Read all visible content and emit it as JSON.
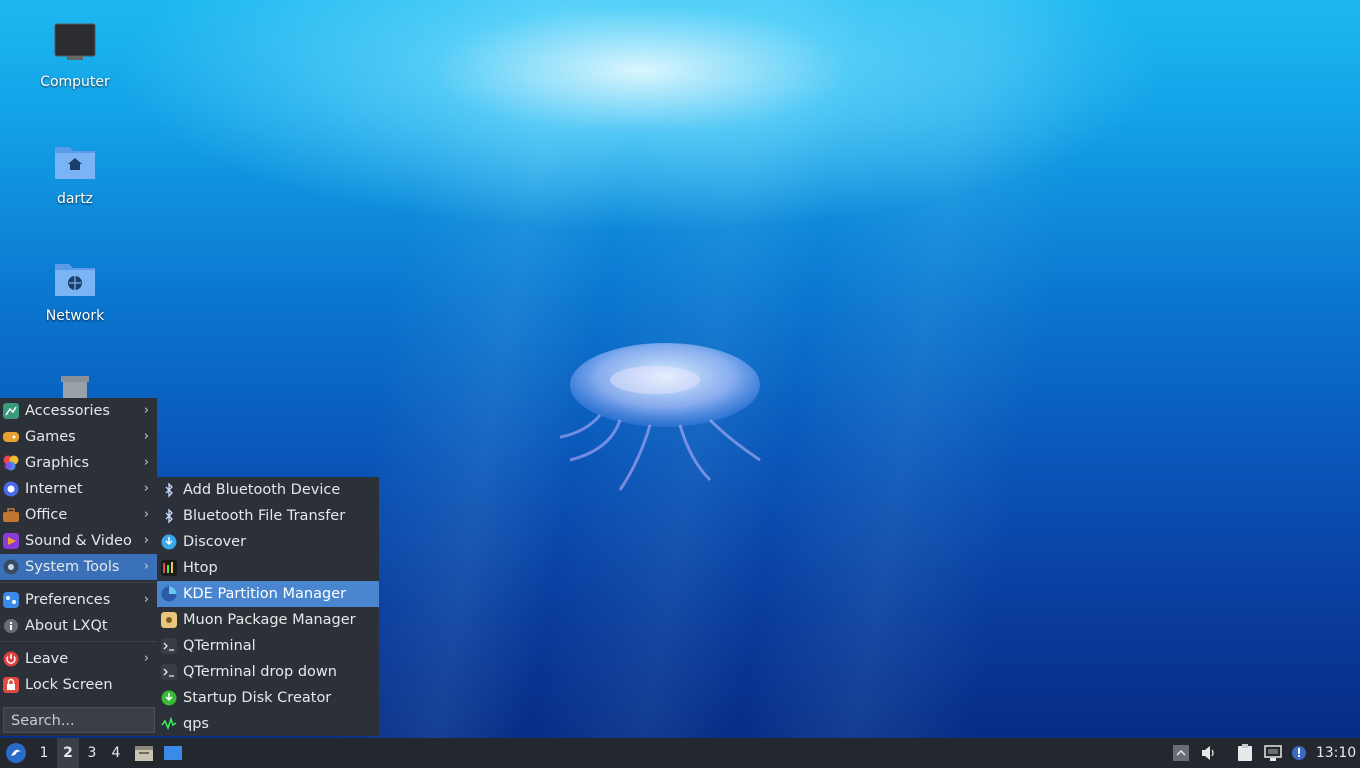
{
  "desktop": {
    "icons": [
      {
        "label": "Computer",
        "icon": "monitor-icon"
      },
      {
        "label": "dartz",
        "icon": "home-folder-icon"
      },
      {
        "label": "Network",
        "icon": "network-folder-icon"
      },
      {
        "label": "",
        "icon": "trash-icon"
      }
    ]
  },
  "main_menu": {
    "items": [
      {
        "label": "Accessories",
        "icon": "accessories-icon",
        "submenu": true
      },
      {
        "label": "Games",
        "icon": "games-icon",
        "submenu": true
      },
      {
        "label": "Graphics",
        "icon": "graphics-icon",
        "submenu": true
      },
      {
        "label": "Internet",
        "icon": "internet-icon",
        "submenu": true
      },
      {
        "label": "Office",
        "icon": "office-icon",
        "submenu": true
      },
      {
        "label": "Sound & Video",
        "icon": "sound-video-icon",
        "submenu": true
      },
      {
        "label": "System Tools",
        "icon": "system-tools-icon",
        "submenu": true,
        "active": true
      },
      {
        "label": "Preferences",
        "icon": "preferences-icon",
        "submenu": true
      },
      {
        "label": "About LXQt",
        "icon": "info-icon",
        "submenu": false
      },
      {
        "label": "Leave",
        "icon": "power-icon",
        "submenu": true
      },
      {
        "label": "Lock Screen",
        "icon": "lock-icon",
        "submenu": false
      }
    ],
    "arrow": "›",
    "search_placeholder": "Search..."
  },
  "system_tools_menu": {
    "items": [
      {
        "label": "Add Bluetooth Device",
        "icon": "bluetooth-icon"
      },
      {
        "label": "Bluetooth File Transfer",
        "icon": "bluetooth-icon"
      },
      {
        "label": "Discover",
        "icon": "discover-icon"
      },
      {
        "label": "Htop",
        "icon": "htop-icon"
      },
      {
        "label": "KDE Partition Manager",
        "icon": "partition-manager-icon",
        "highlighted": true
      },
      {
        "label": "Muon Package Manager",
        "icon": "muon-icon"
      },
      {
        "label": "QTerminal",
        "icon": "terminal-icon"
      },
      {
        "label": "QTerminal drop down",
        "icon": "terminal-icon"
      },
      {
        "label": "Startup Disk Creator",
        "icon": "startup-disk-icon"
      },
      {
        "label": "qps",
        "icon": "qps-icon"
      }
    ]
  },
  "taskbar": {
    "desktops": [
      "1",
      "2",
      "3",
      "4"
    ],
    "current_desktop": "2",
    "clock": "13:10"
  },
  "colors": {
    "menu_bg": "#2c3038",
    "active": "#3a70b8",
    "highlight": "#4a86d0",
    "taskbar_bg": "#24272d"
  }
}
